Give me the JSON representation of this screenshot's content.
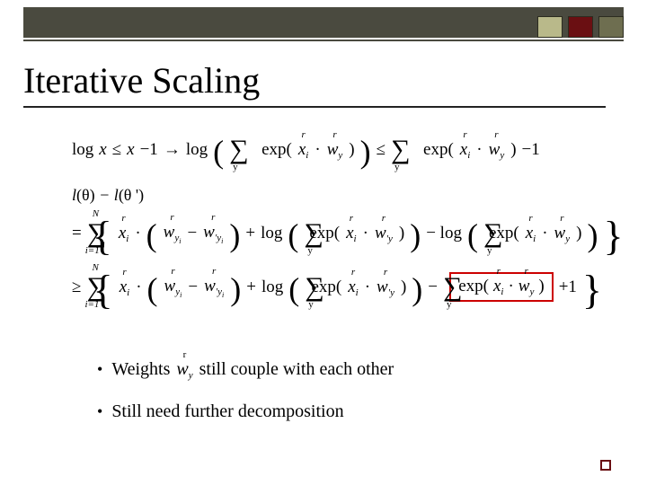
{
  "slide": {
    "title": "Iterative Scaling"
  },
  "math": {
    "line1": {
      "lhs_pre": "log",
      "lhs_var": "x",
      "le1": "≤",
      "rhs1_a": "x",
      "rhs1_minus": "−1",
      "arrow": "→",
      "rhs2_pre": "log",
      "sum_sub": "y",
      "exp": "exp(",
      "xi": "x",
      "xi_sub": "i",
      "dot": "·",
      "wy": "w",
      "wy_sub": "y",
      "close": ")",
      "le2": "≤",
      "tail_minus": "−1"
    },
    "ll": {
      "text_a": "l",
      "theta": "(θ)",
      "minus": "−",
      "text_b": "l",
      "theta_p": "(θ ')"
    },
    "line2": {
      "eq": "=",
      "sum_lo": "i=1",
      "sum_hi": "N",
      "xi": "x",
      "xi_sub": "i",
      "dot": "·",
      "minus": "−",
      "w": "w",
      "wyi_sub": "y",
      "wyi_sub2": "i",
      "plus": "+",
      "log": "log",
      "sum_sub": "y",
      "exp": "exp(",
      "close": ")",
      "minuslog": "− log",
      "tail": ""
    },
    "line3": {
      "ge": "≥",
      "sum_lo": "i=1",
      "sum_hi": "N",
      "plus1": "+1"
    }
  },
  "bullets": {
    "b1_pre": "Weights",
    "b1_vec": "w",
    "b1_vec_sub": "y",
    "b1_post": "still couple with each other",
    "b2": "Still need further decomposition"
  }
}
